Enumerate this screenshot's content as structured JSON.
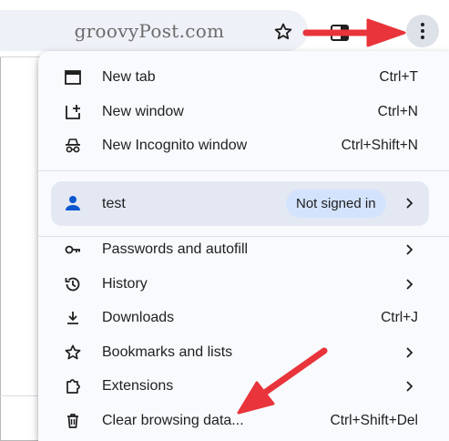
{
  "browser": {
    "omnibox_text": "groovyPost.com"
  },
  "menu": {
    "items_top": [
      {
        "label": "New tab",
        "shortcut": "Ctrl+T",
        "icon": "new-tab-icon"
      },
      {
        "label": "New window",
        "shortcut": "Ctrl+N",
        "icon": "new-window-icon"
      },
      {
        "label": "New Incognito window",
        "shortcut": "Ctrl+Shift+N",
        "icon": "incognito-icon"
      }
    ],
    "profile": {
      "name": "test",
      "status": "Not signed in",
      "icon": "person-icon"
    },
    "items_bottom": [
      {
        "label": "Passwords and autofill",
        "shortcut": "",
        "icon": "key-icon",
        "submenu": true
      },
      {
        "label": "History",
        "shortcut": "",
        "icon": "history-icon",
        "submenu": true
      },
      {
        "label": "Downloads",
        "shortcut": "Ctrl+J",
        "icon": "download-icon",
        "submenu": false
      },
      {
        "label": "Bookmarks and lists",
        "shortcut": "",
        "icon": "star-outline-icon",
        "submenu": true
      },
      {
        "label": "Extensions",
        "shortcut": "",
        "icon": "puzzle-icon",
        "submenu": true
      },
      {
        "label": "Clear browsing data...",
        "shortcut": "Ctrl+Shift+Del",
        "icon": "trash-icon",
        "submenu": false
      }
    ]
  },
  "annotation": {
    "arrow_color": "#e8343a"
  }
}
